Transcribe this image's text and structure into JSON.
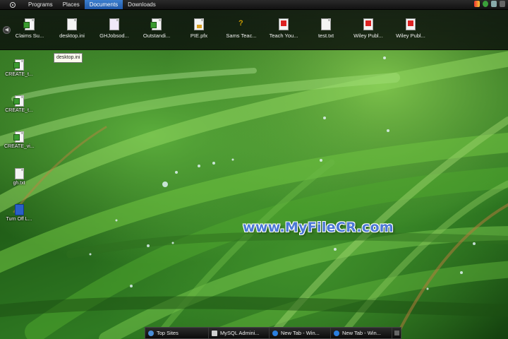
{
  "menubar": {
    "items": [
      {
        "label": "Programs",
        "active": false
      },
      {
        "label": "Places",
        "active": false
      },
      {
        "label": "Documents",
        "active": true
      },
      {
        "label": "Downloads",
        "active": false
      }
    ]
  },
  "documents_strip": {
    "items": [
      {
        "label": "Claims Su...",
        "icon": "spreadsheet-icon"
      },
      {
        "label": "desktop.ini",
        "icon": "settings-file-icon"
      },
      {
        "label": "GHJobsod...",
        "icon": "document-icon"
      },
      {
        "label": "Outstandi...",
        "icon": "spreadsheet-icon"
      },
      {
        "label": "PIE.pfx",
        "icon": "certificate-icon"
      },
      {
        "label": "Sams Teac...",
        "icon": "help-file-icon"
      },
      {
        "label": "Teach You...",
        "icon": "pdf-icon"
      },
      {
        "label": "test.txt",
        "icon": "text-file-icon"
      },
      {
        "label": "Wiley Publ...",
        "icon": "pdf-icon"
      },
      {
        "label": "Wiley Publ...",
        "icon": "pdf-icon"
      }
    ]
  },
  "tooltip": {
    "text": "desktop.ini"
  },
  "desktop": {
    "icons": [
      {
        "label": "CREATE_t...",
        "icon": "spreadsheet-icon"
      },
      {
        "label": "CREATE_t...",
        "icon": "spreadsheet-icon"
      },
      {
        "label": "CREATE_vi...",
        "icon": "spreadsheet-icon"
      },
      {
        "label": "gh.txt",
        "icon": "text-file-icon"
      },
      {
        "label": "Turn Off L...",
        "icon": "monitor-icon"
      }
    ]
  },
  "watermark": {
    "text": "www.MyFileCR.com"
  },
  "taskbar": {
    "tasks": [
      {
        "label": "Top Sites",
        "icon": "browser-icon"
      },
      {
        "label": "MySQL Admini...",
        "icon": "mysql-icon"
      },
      {
        "label": "New Tab - Win...",
        "icon": "ie-icon"
      },
      {
        "label": "New Tab - Win...",
        "icon": "ie-icon"
      }
    ]
  },
  "colors": {
    "menu_active": "#2f6fc0",
    "watermark": "#4b78d6",
    "grass": "#3b7f27"
  }
}
